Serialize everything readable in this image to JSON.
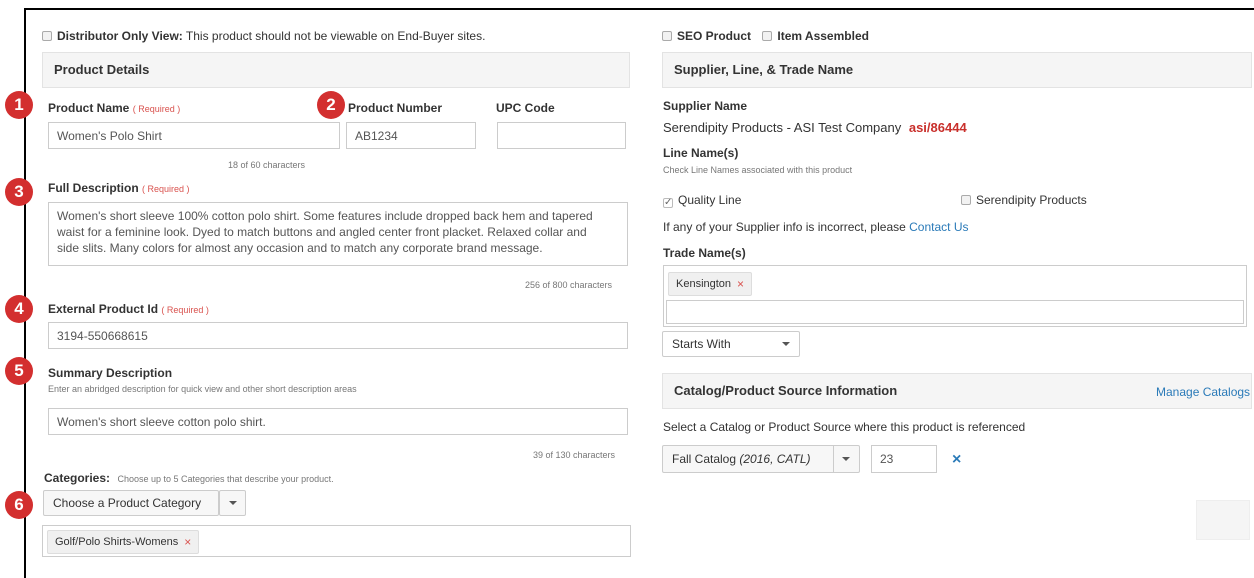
{
  "left": {
    "distributor_only": {
      "label": "Distributor Only View:",
      "text": "This product should not be viewable on End-Buyer sites."
    },
    "product_details_header": "Product Details",
    "product_name": {
      "label": "Product Name",
      "required": "( Required )",
      "value": "Women's Polo Shirt",
      "counter": "18 of 60 characters"
    },
    "product_number": {
      "label": "Product Number",
      "value": "AB1234"
    },
    "upc_code": {
      "label": "UPC Code",
      "value": ""
    },
    "full_description": {
      "label": "Full Description",
      "required": "( Required )",
      "lines": [
        "Women's short sleeve 100% cotton polo shirt. Some features include dropped back hem and tapered",
        "waist for a feminine look. Dyed to match buttons and angled center front placket. Relaxed collar and",
        "side slits. Many colors for almost any occasion and to match any corporate brand message."
      ],
      "counter": "256 of 800 characters"
    },
    "external_product_id": {
      "label": "External Product Id",
      "required": "( Required )",
      "value": "3194-550668615"
    },
    "summary_description": {
      "label": "Summary Description",
      "hint": "Enter an abridged description for quick view and other short description areas",
      "value": "Women's short sleeve cotton polo shirt.",
      "counter": "39 of 130 characters"
    },
    "categories": {
      "label": "Categories:",
      "hint": "Choose up to 5 Categories that describe your product.",
      "button": "Choose a Product Category",
      "tag": "Golf/Polo Shirts-Womens"
    },
    "badges": [
      "1",
      "2",
      "3",
      "4",
      "5",
      "6"
    ]
  },
  "right": {
    "seo_product": "SEO Product",
    "item_assembled": "Item Assembled",
    "supplier_header": "Supplier, Line, & Trade Name",
    "supplier_name_label": "Supplier Name",
    "supplier_name": "Serendipity Products - ASI Test Company",
    "asi_number": "asi/86444",
    "line_names_label": "Line Name(s)",
    "line_names_hint": "Check Line Names associated with this product",
    "line_quality": "Quality Line",
    "line_serendipity": "Serendipity Products",
    "incorrect_text": "If any of your Supplier info is incorrect, please",
    "contact_us": "Contact Us",
    "trade_names_label": "Trade Name(s)",
    "trade_tag": "Kensington",
    "starts_with": "Starts With",
    "catalog_header": "Catalog/Product Source Information",
    "manage_catalogs": "Manage Catalogs",
    "catalog_hint": "Select a Catalog or Product Source where this product is referenced",
    "catalog_name": "Fall Catalog",
    "catalog_detail": "(2016, CATL)",
    "catalog_page": "23"
  }
}
